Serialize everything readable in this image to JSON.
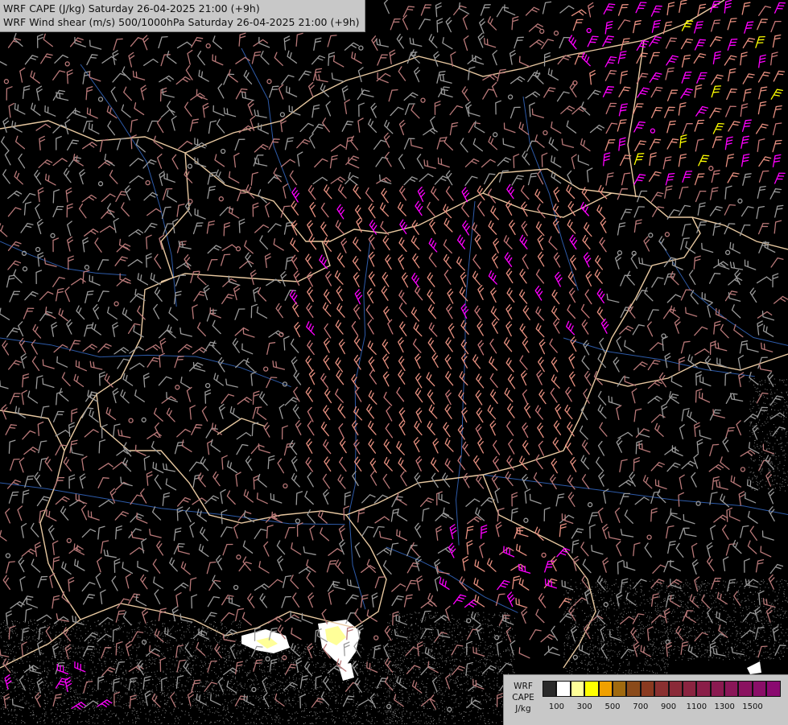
{
  "header": {
    "line1": "WRF CAPE (J/kg) Saturday 26-04-2025 21:00 (+9h)",
    "line2": "WRF Wind shear (m/s) 500/1000hPa Saturday 26-04-2025 21:00 (+9h)"
  },
  "legend": {
    "label1": "WRF",
    "label2": "CAPE",
    "label3": "J/kg",
    "colors": [
      "#2a2a2a",
      "#ffffff",
      "#ffff99",
      "#ffff00",
      "#f0a000",
      "#a06a10",
      "#8a4a1a",
      "#8a3a20",
      "#8a3030",
      "#8a2a38",
      "#8a2440",
      "#8a1e48",
      "#8a1a50",
      "#8a1658",
      "#8a1260",
      "#8a0e68",
      "#8a0a70"
    ],
    "ticks": [
      {
        "label": "100",
        "index": 1
      },
      {
        "label": "300",
        "index": 3
      },
      {
        "label": "500",
        "index": 5
      },
      {
        "label": "700",
        "index": 7
      },
      {
        "label": "900",
        "index": 9
      },
      {
        "label": "1100",
        "index": 11
      },
      {
        "label": "1300",
        "index": 13
      },
      {
        "label": "1500",
        "index": 15
      }
    ]
  }
}
